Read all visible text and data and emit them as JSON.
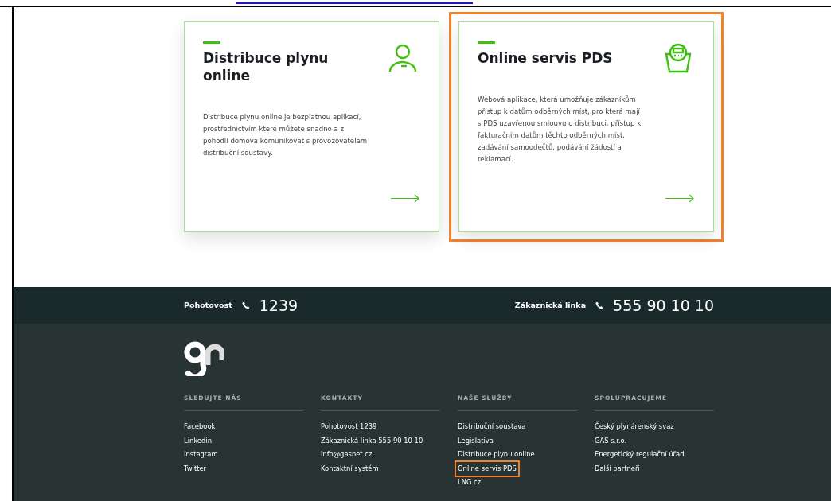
{
  "cards": [
    {
      "title": "Distribuce plynu online",
      "text": "Distribuce plynu online je bezplatnou aplikací, prostřednictvím které můžete snadno a z pohodlí domova komunikovat s provozovatelem distribuční soustavy.",
      "kind": "person",
      "highlighted": false
    },
    {
      "title": "Online servis PDS",
      "text": "Webová aplikace, která umožňuje zákazníkům přístup k datům odběrných míst, pro která mají s PDS uzavřenou smlouvu o distribuci, přístup k fakturačním datům těchto odběrných míst, zadávání samoodečtů, podávání žádostí a reklamací.",
      "kind": "meter",
      "highlighted": true
    }
  ],
  "hotline": [
    {
      "label": "Pohotovost",
      "number": "1239"
    },
    {
      "label": "Zákaznická linka",
      "number": "555 90 10 10"
    }
  ],
  "footer_columns": [
    {
      "heading": "SLEDUJTE NÁS",
      "links": [
        {
          "text": "Facebook",
          "highlighted": false
        },
        {
          "text": "Linkedin",
          "highlighted": false
        },
        {
          "text": "Instagram",
          "highlighted": false
        },
        {
          "text": "Twitter",
          "highlighted": false
        }
      ]
    },
    {
      "heading": "KONTAKTY",
      "links": [
        {
          "text": "Pohotovost 1239",
          "highlighted": false
        },
        {
          "text": "Zákaznická linka 555 90 10 10",
          "highlighted": false
        },
        {
          "text": "info@gasnet.cz",
          "highlighted": false
        },
        {
          "text": "Kontaktní systém",
          "highlighted": false
        }
      ]
    },
    {
      "heading": "NAŠE SLUŽBY",
      "links": [
        {
          "text": "Distribuční soustava",
          "highlighted": false
        },
        {
          "text": "Legislativa",
          "highlighted": false
        },
        {
          "text": "Distribuce plynu online",
          "highlighted": false
        },
        {
          "text": "Online servis PDS",
          "highlighted": true
        },
        {
          "text": "LNG.cz",
          "highlighted": false
        }
      ]
    },
    {
      "heading": "SPOLUPRACUJEME",
      "links": [
        {
          "text": "Český plynárenský svaz",
          "highlighted": false
        },
        {
          "text": "GAS s.r.o.",
          "highlighted": false
        },
        {
          "text": "Energetický regulační úřad",
          "highlighted": false
        },
        {
          "text": "Další partneři",
          "highlighted": false
        }
      ]
    }
  ]
}
